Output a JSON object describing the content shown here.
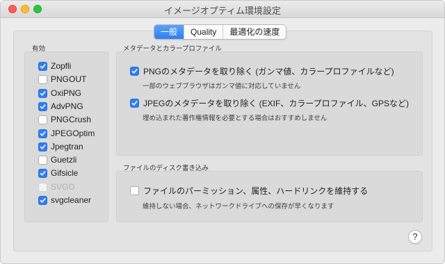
{
  "window": {
    "title": "イメージオプティム環境設定"
  },
  "tabs": [
    {
      "label": "一般",
      "active": true
    },
    {
      "label": "Quality",
      "active": false
    },
    {
      "label": "最適化の速度",
      "active": false
    }
  ],
  "enabled_section": {
    "label": "有効",
    "items": [
      {
        "label": "Zopfli",
        "checked": true,
        "disabled": false
      },
      {
        "label": "PNGOUT",
        "checked": false,
        "disabled": false
      },
      {
        "label": "OxiPNG",
        "checked": true,
        "disabled": false
      },
      {
        "label": "AdvPNG",
        "checked": true,
        "disabled": false
      },
      {
        "label": "PNGCrush",
        "checked": false,
        "disabled": false
      },
      {
        "label": "JPEGOptim",
        "checked": true,
        "disabled": false
      },
      {
        "label": "Jpegtran",
        "checked": true,
        "disabled": false
      },
      {
        "label": "Guetzli",
        "checked": false,
        "disabled": false
      },
      {
        "label": "Gifsicle",
        "checked": true,
        "disabled": false
      },
      {
        "label": "SVGO",
        "checked": false,
        "disabled": true
      },
      {
        "label": "svgcleaner",
        "checked": true,
        "disabled": false
      }
    ]
  },
  "metadata_section": {
    "label": "メタデータとカラープロファイル",
    "png_option": {
      "label": "PNGのメタデータを取り除く (ガンマ値、カラープロファイルなど)",
      "checked": true,
      "description": "一部のウェブブラウザはガンマ値に対応していません"
    },
    "jpeg_option": {
      "label": "JPEGのメタデータを取り除く (EXIF、カラープロファイル、GPSなど)",
      "checked": true,
      "description": "埋め込まれた著作権情報を必要とする場合はおすすめしません"
    }
  },
  "disk_section": {
    "label": "ファイルのディスク書き込み",
    "preserve_option": {
      "label": "ファイルのパーミッション、属性、ハードリンクを維持する",
      "checked": false,
      "description": "維持しない場合、ネットワークドライブへの保存が早くなります"
    }
  },
  "help": {
    "symbol": "?"
  },
  "colors": {
    "accent": "#2f7ef2",
    "background": "#ececec"
  }
}
